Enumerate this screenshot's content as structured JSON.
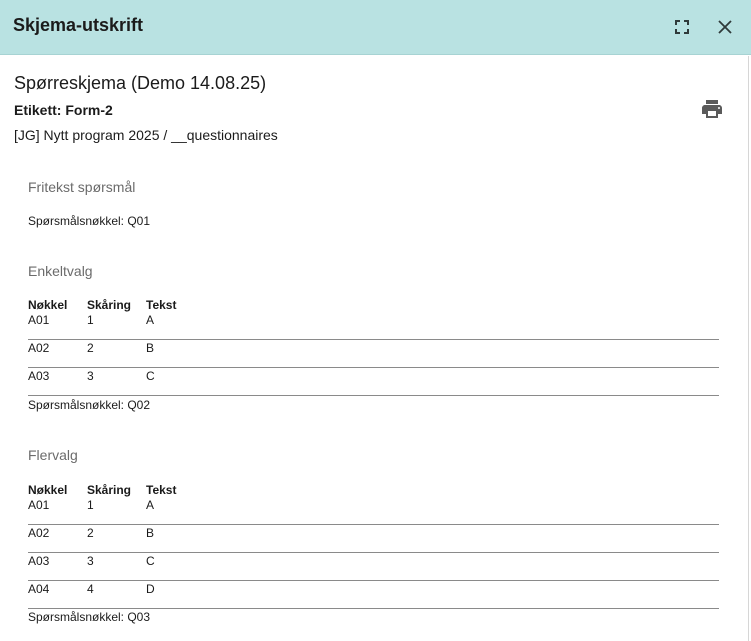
{
  "dialog": {
    "title": "Skjema-utskrift"
  },
  "form": {
    "title": "Spørreskjema (Demo 14.08.25)",
    "label": "Etikett: Form-2",
    "path": "[JG] Nytt program 2025 / __questionnaires"
  },
  "table_headers": {
    "key": "Nøkkel",
    "score": "Skåring",
    "text": "Tekst"
  },
  "questions": [
    {
      "title": "Fritekst spørsmål",
      "key_text": "Spørsmålsnøkkel: Q01",
      "options": []
    },
    {
      "title": "Enkeltvalg",
      "key_text": "Spørsmålsnøkkel: Q02",
      "options": [
        {
          "key": "A01",
          "score": "1",
          "text": "A"
        },
        {
          "key": "A02",
          "score": "2",
          "text": "B"
        },
        {
          "key": "A03",
          "score": "3",
          "text": "C"
        }
      ]
    },
    {
      "title": "Flervalg",
      "key_text": "Spørsmålsnøkkel: Q03",
      "options": [
        {
          "key": "A01",
          "score": "1",
          "text": "A"
        },
        {
          "key": "A02",
          "score": "2",
          "text": "B"
        },
        {
          "key": "A03",
          "score": "3",
          "text": "C"
        },
        {
          "key": "A04",
          "score": "4",
          "text": "D"
        }
      ]
    }
  ],
  "icons": {
    "fullscreen": "fullscreen-icon",
    "close": "close-icon",
    "print": "print-icon"
  },
  "colors": {
    "titlebar_bg": "#b9e2e2",
    "muted_text": "#6b6b6b",
    "icon": "#5a5a5a"
  }
}
